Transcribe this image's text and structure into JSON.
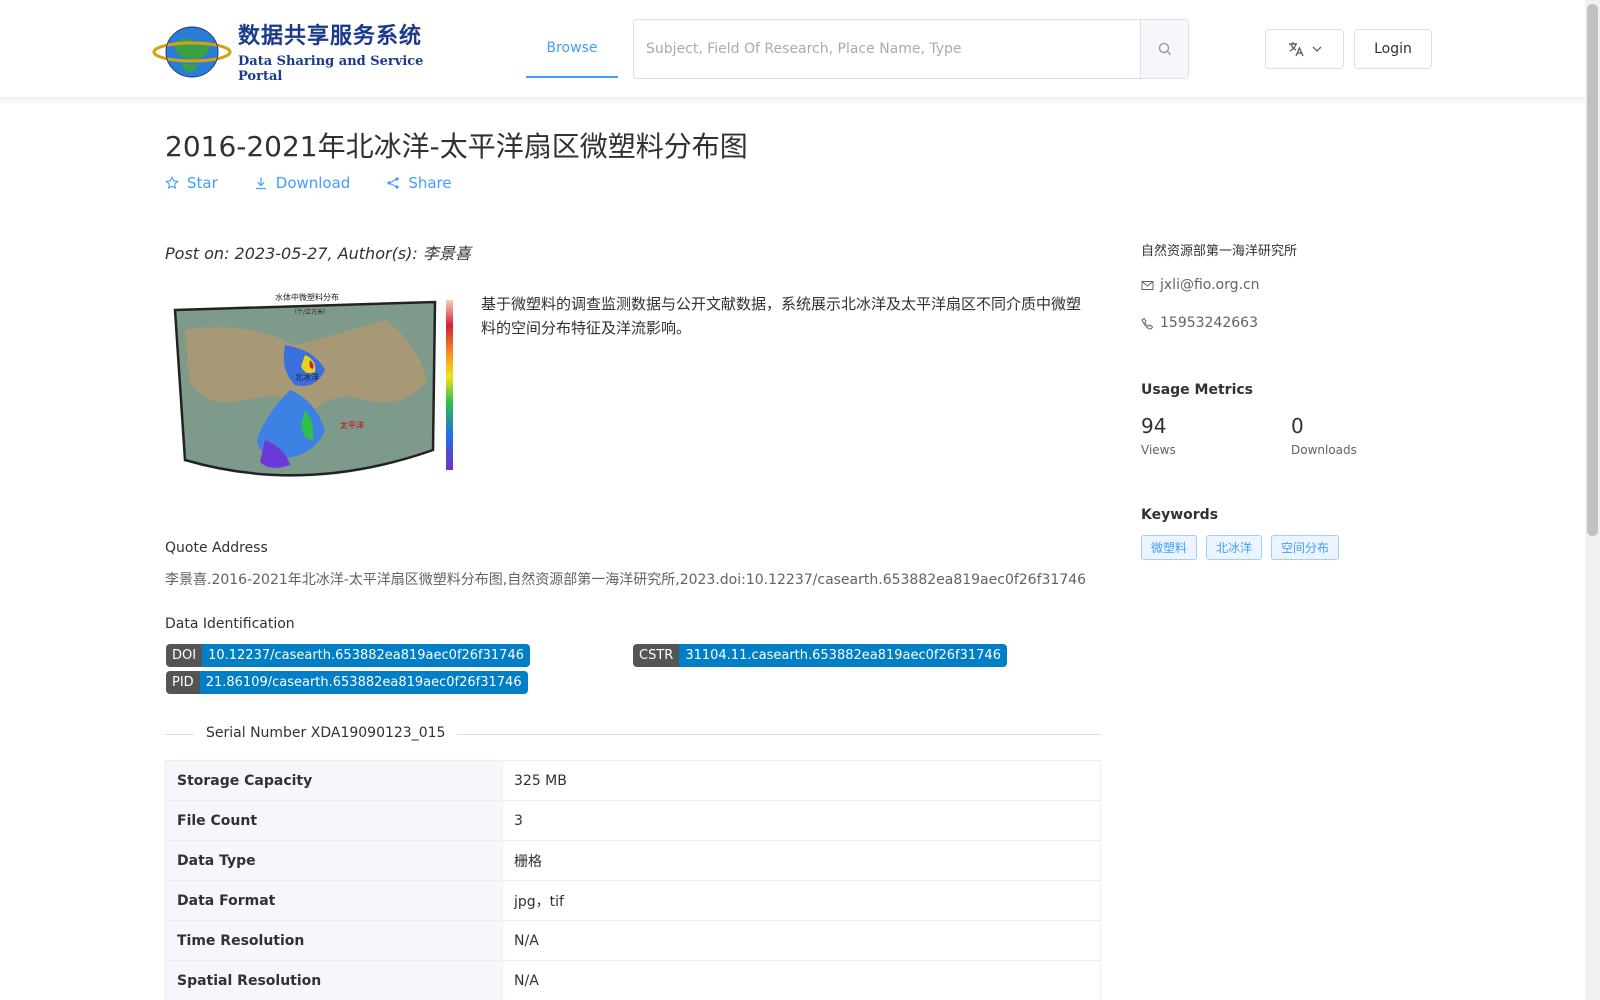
{
  "header": {
    "logo_cn": "数据共享服务系统",
    "logo_en": "Data Sharing and Service Portal",
    "nav_browse": "Browse",
    "search_placeholder": "Subject, Field Of Research, Place Name, Type",
    "login_label": "Login"
  },
  "dataset": {
    "title": "2016-2021年北冰洋-太平洋扇区微塑料分布图",
    "actions": {
      "star": "Star",
      "download": "Download",
      "share": "Share"
    },
    "post_on": "Post on: 2023-05-27, Author(s): 李景喜",
    "thumb_title": "水体中微塑料分布",
    "thumb_subtitle": "（个/立方米）",
    "thumb_label_arctic": "北冰洋",
    "thumb_label_pacific": "太平洋",
    "description": "基于微塑料的调查监测数据与公开文献数据，系统展示北冰洋及太平洋扇区不同介质中微塑料的空间分布特征及洋流影响。",
    "quote_label": "Quote Address",
    "quote_text": "李景喜.2016-2021年北冰洋-太平洋扇区微塑料分布图,自然资源部第一海洋研究所,2023.doi:10.12237/casearth.653882ea819aec0f26f31746",
    "identification_label": "Data Identification",
    "identifiers": {
      "doi": {
        "key": "DOI",
        "value": "10.12237/casearth.653882ea819aec0f26f31746"
      },
      "cstr": {
        "key": "CSTR",
        "value": "31104.11.casearth.653882ea819aec0f26f31746"
      },
      "pid": {
        "key": "PID",
        "value": "21.86109/casearth.653882ea819aec0f26f31746"
      }
    },
    "serial_number": "Serial Number XDA19090123_015",
    "table": [
      {
        "key": "Storage Capacity",
        "value": "325 MB"
      },
      {
        "key": "File Count",
        "value": "3"
      },
      {
        "key": "Data Type",
        "value": "栅格"
      },
      {
        "key": "Data Format",
        "value": "jpg，tif"
      },
      {
        "key": "Time Resolution",
        "value": "N/A"
      },
      {
        "key": "Spatial Resolution",
        "value": "N/A"
      }
    ]
  },
  "sidebar": {
    "org": "自然资源部第一海洋研究所",
    "email": "jxli@fio.org.cn",
    "phone": "15953242663",
    "usage_title": "Usage Metrics",
    "views": "94",
    "views_label": "Views",
    "downloads": "0",
    "downloads_label": "Downloads",
    "keywords_title": "Keywords",
    "keywords": [
      "微塑料",
      "北冰洋",
      "空间分布"
    ]
  },
  "colors": {
    "accent": "#409eff",
    "badge_key": "#555555",
    "badge_value": "#007ec6"
  }
}
